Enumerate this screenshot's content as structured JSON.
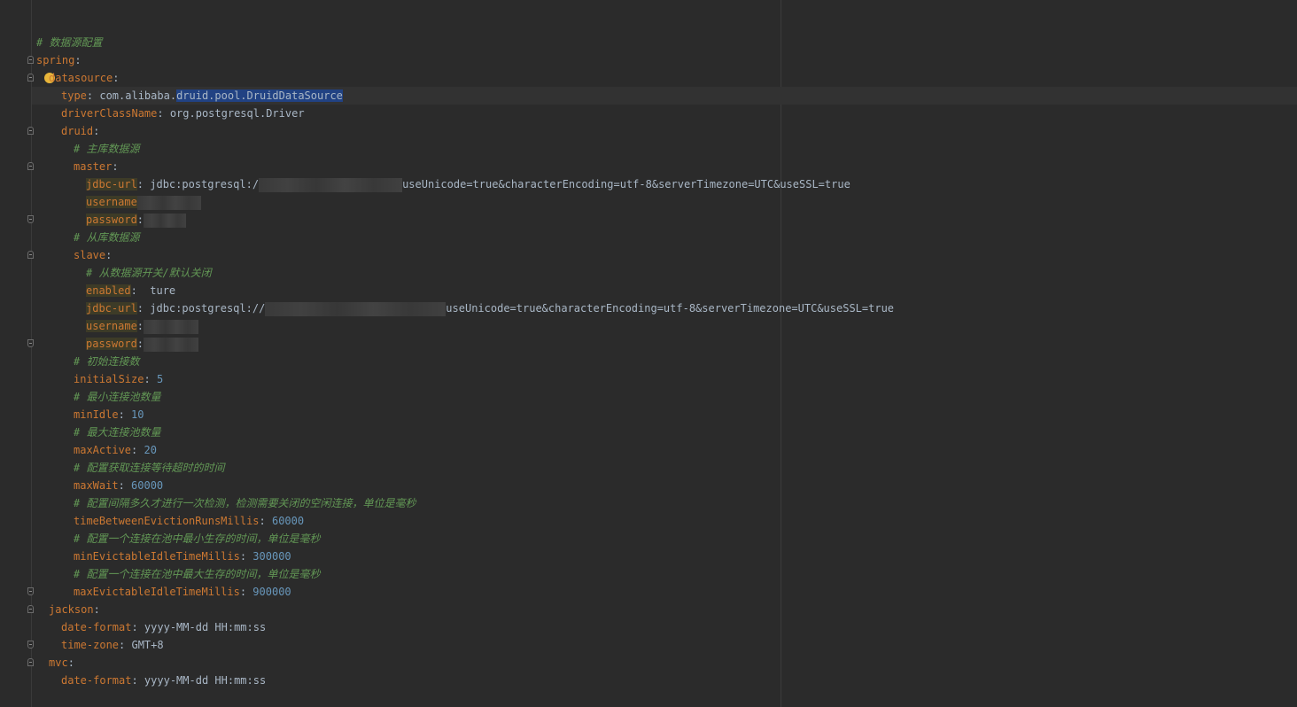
{
  "editor": {
    "lines": [
      {
        "indent": 0,
        "fold": "",
        "parts": [
          {
            "t": "c",
            "s": "# 数据源配置"
          }
        ]
      },
      {
        "indent": 0,
        "fold": "start",
        "parts": [
          {
            "t": "k",
            "s": "spring"
          },
          {
            "t": "v",
            "s": ":"
          }
        ]
      },
      {
        "indent": 1,
        "fold": "start",
        "bulb": true,
        "parts": [
          {
            "t": "k",
            "s": "datasource"
          },
          {
            "t": "v",
            "s": ":"
          }
        ]
      },
      {
        "indent": 2,
        "fold": "",
        "parts": [
          {
            "t": "k",
            "s": "type"
          },
          {
            "t": "v",
            "s": ": com.alibaba."
          },
          {
            "t": "sel",
            "s": "druid.pool.DruidDataSource"
          }
        ]
      },
      {
        "indent": 2,
        "fold": "",
        "parts": [
          {
            "t": "k",
            "s": "driverClassName"
          },
          {
            "t": "v",
            "s": ": org.postgresql.Driver"
          }
        ]
      },
      {
        "indent": 2,
        "fold": "start",
        "parts": [
          {
            "t": "k",
            "s": "druid"
          },
          {
            "t": "v",
            "s": ":"
          }
        ]
      },
      {
        "indent": 3,
        "fold": "",
        "parts": [
          {
            "t": "c",
            "s": "# 主库数据源"
          }
        ]
      },
      {
        "indent": 3,
        "fold": "start",
        "parts": [
          {
            "t": "k",
            "s": "master"
          },
          {
            "t": "v",
            "s": ":"
          }
        ]
      },
      {
        "indent": 4,
        "fold": "",
        "parts": [
          {
            "t": "kh",
            "s": "jdbc-url"
          },
          {
            "t": "v",
            "s": ": jdbc:postgresql:/"
          },
          {
            "t": "blur",
            "w": 162
          },
          {
            "t": "v",
            "s": "useUnicode=true&characterEncoding=utf-8&serverTimezone=UTC&useSSL=true"
          }
        ]
      },
      {
        "indent": 4,
        "fold": "",
        "parts": [
          {
            "t": "kh",
            "s": "username"
          },
          {
            "t": "blur",
            "w": 72
          }
        ]
      },
      {
        "indent": 4,
        "fold": "end",
        "parts": [
          {
            "t": "kh",
            "s": "password"
          },
          {
            "t": "v",
            "s": ":"
          },
          {
            "t": "blur",
            "w": 48
          }
        ]
      },
      {
        "indent": 3,
        "fold": "",
        "parts": [
          {
            "t": "c",
            "s": "# 从库数据源"
          }
        ]
      },
      {
        "indent": 3,
        "fold": "start",
        "parts": [
          {
            "t": "k",
            "s": "slave"
          },
          {
            "t": "v",
            "s": ":"
          }
        ]
      },
      {
        "indent": 4,
        "fold": "",
        "parts": [
          {
            "t": "c",
            "s": "# 从数据源开关/默认关闭"
          }
        ]
      },
      {
        "indent": 4,
        "fold": "",
        "parts": [
          {
            "t": "kh",
            "s": "enabled"
          },
          {
            "t": "v",
            "s": ":  ture"
          }
        ]
      },
      {
        "indent": 4,
        "fold": "",
        "parts": [
          {
            "t": "kh",
            "s": "jdbc-url"
          },
          {
            "t": "v",
            "s": ": jdbc:postgresql://"
          },
          {
            "t": "blur",
            "w": 204
          },
          {
            "t": "v",
            "s": "useUnicode=true&characterEncoding=utf-8&serverTimezone=UTC&useSSL=true"
          }
        ]
      },
      {
        "indent": 4,
        "fold": "",
        "parts": [
          {
            "t": "kh",
            "s": "username"
          },
          {
            "t": "v",
            "s": ":"
          },
          {
            "t": "blur",
            "w": 62
          }
        ]
      },
      {
        "indent": 4,
        "fold": "end",
        "parts": [
          {
            "t": "kh",
            "s": "password"
          },
          {
            "t": "v",
            "s": ":"
          },
          {
            "t": "blur",
            "w": 62
          }
        ]
      },
      {
        "indent": 3,
        "fold": "",
        "parts": [
          {
            "t": "c",
            "s": "# 初始连接数"
          }
        ]
      },
      {
        "indent": 3,
        "fold": "",
        "parts": [
          {
            "t": "k",
            "s": "initialSize"
          },
          {
            "t": "v",
            "s": ": "
          },
          {
            "t": "n",
            "s": "5"
          }
        ]
      },
      {
        "indent": 3,
        "fold": "",
        "parts": [
          {
            "t": "c",
            "s": "# 最小连接池数量"
          }
        ]
      },
      {
        "indent": 3,
        "fold": "",
        "parts": [
          {
            "t": "k",
            "s": "minIdle"
          },
          {
            "t": "v",
            "s": ": "
          },
          {
            "t": "n",
            "s": "10"
          }
        ]
      },
      {
        "indent": 3,
        "fold": "",
        "parts": [
          {
            "t": "c",
            "s": "# 最大连接池数量"
          }
        ]
      },
      {
        "indent": 3,
        "fold": "",
        "parts": [
          {
            "t": "k",
            "s": "maxActive"
          },
          {
            "t": "v",
            "s": ": "
          },
          {
            "t": "n",
            "s": "20"
          }
        ]
      },
      {
        "indent": 3,
        "fold": "",
        "parts": [
          {
            "t": "c",
            "s": "# 配置获取连接等待超时的时间"
          }
        ]
      },
      {
        "indent": 3,
        "fold": "",
        "parts": [
          {
            "t": "k",
            "s": "maxWait"
          },
          {
            "t": "v",
            "s": ": "
          },
          {
            "t": "n",
            "s": "60000"
          }
        ]
      },
      {
        "indent": 3,
        "fold": "",
        "parts": [
          {
            "t": "c",
            "s": "# 配置间隔多久才进行一次检测，检测需要关闭的空闲连接，单位是毫秒"
          }
        ]
      },
      {
        "indent": 3,
        "fold": "",
        "parts": [
          {
            "t": "k",
            "s": "timeBetweenEvictionRunsMillis"
          },
          {
            "t": "v",
            "s": ": "
          },
          {
            "t": "n",
            "s": "60000"
          }
        ]
      },
      {
        "indent": 3,
        "fold": "",
        "parts": [
          {
            "t": "c",
            "s": "# 配置一个连接在池中最小生存的时间，单位是毫秒"
          }
        ]
      },
      {
        "indent": 3,
        "fold": "",
        "parts": [
          {
            "t": "k",
            "s": "minEvictableIdleTimeMillis"
          },
          {
            "t": "v",
            "s": ": "
          },
          {
            "t": "n",
            "s": "300000"
          }
        ]
      },
      {
        "indent": 3,
        "fold": "",
        "parts": [
          {
            "t": "c",
            "s": "# 配置一个连接在池中最大生存的时间，单位是毫秒"
          }
        ]
      },
      {
        "indent": 3,
        "fold": "end",
        "parts": [
          {
            "t": "k",
            "s": "maxEvictableIdleTimeMillis"
          },
          {
            "t": "v",
            "s": ": "
          },
          {
            "t": "n",
            "s": "900000"
          }
        ]
      },
      {
        "indent": 1,
        "fold": "start",
        "parts": [
          {
            "t": "k",
            "s": "jackson"
          },
          {
            "t": "v",
            "s": ":"
          }
        ]
      },
      {
        "indent": 2,
        "fold": "",
        "parts": [
          {
            "t": "k",
            "s": "date-format"
          },
          {
            "t": "v",
            "s": ": yyyy-MM-dd HH:mm:ss"
          }
        ]
      },
      {
        "indent": 2,
        "fold": "end",
        "parts": [
          {
            "t": "k",
            "s": "time-zone"
          },
          {
            "t": "v",
            "s": ": GMT+8"
          }
        ]
      },
      {
        "indent": 1,
        "fold": "start",
        "parts": [
          {
            "t": "k",
            "s": "mvc"
          },
          {
            "t": "v",
            "s": ":"
          }
        ]
      },
      {
        "indent": 2,
        "fold": "",
        "parts": [
          {
            "t": "k",
            "s": "date-format"
          },
          {
            "t": "v",
            "s": ": yyyy-MM-dd HH:mm:ss"
          }
        ]
      }
    ]
  },
  "colors": {
    "background": "#2b2b2b",
    "key": "#cc7832",
    "comment": "#629755",
    "number": "#6897bb",
    "text": "#a9b7c6",
    "selection": "#214283"
  },
  "icons": {
    "bulb": "lightbulb-icon",
    "fold": "fold-marker-icon"
  }
}
